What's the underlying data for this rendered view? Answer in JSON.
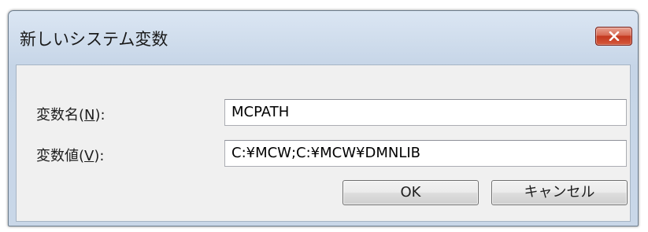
{
  "window": {
    "title": "新しいシステム変数"
  },
  "form": {
    "name_label_prefix": "変数名(",
    "name_label_mnemonic": "N",
    "name_label_suffix": "):",
    "name_value": "MCPATH",
    "value_label_prefix": "変数値(",
    "value_label_mnemonic": "V",
    "value_label_suffix": "):",
    "value_value": "C:¥MCW;C:¥MCW¥DMNLIB"
  },
  "buttons": {
    "ok_label": "OK",
    "cancel_label": "キャンセル"
  },
  "icons": {
    "close": "close-icon"
  },
  "colors": {
    "close_button": "#c3391f",
    "titlebar": "#c6d5e7"
  }
}
